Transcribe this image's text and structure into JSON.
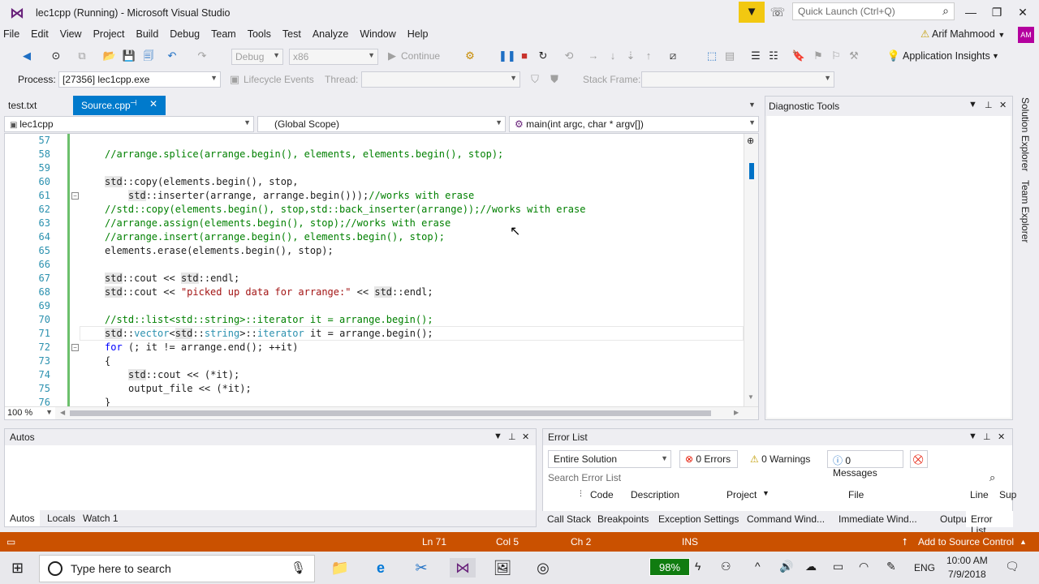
{
  "window": {
    "title": "lec1cpp (Running) - Microsoft Visual Studio",
    "quick_launch_placeholder": "Quick Launch (Ctrl+Q)",
    "minimize": "—",
    "maximize": "❐",
    "close": "✕"
  },
  "menu": [
    "File",
    "Edit",
    "View",
    "Project",
    "Build",
    "Debug",
    "Team",
    "Tools",
    "Test",
    "Analyze",
    "Window",
    "Help"
  ],
  "user": {
    "warning": "⚠",
    "name": "Arif Mahmood",
    "initials": "AM"
  },
  "toolbar": {
    "config": "Debug",
    "platform": "x86",
    "continue_label": "Continue",
    "app_insights": "Application Insights"
  },
  "debug_toolbar": {
    "process_label": "Process:",
    "process_value": "[27356] lec1cpp.exe",
    "lifecycle_label": "Lifecycle Events",
    "thread_label": "Thread:",
    "stack_frame_label": "Stack Frame:"
  },
  "tabs": {
    "tab1": "test.txt",
    "tab2": "Source.cpp"
  },
  "nav": {
    "project": "lec1cpp",
    "scope": "(Global Scope)",
    "member": "main(int argc, char * argv[])"
  },
  "editor": {
    "zoom": "100 %",
    "line_numbers": [
      "57",
      "58",
      "59",
      "60",
      "61",
      "62",
      "63",
      "64",
      "65",
      "66",
      "67",
      "68",
      "69",
      "70",
      "71",
      "72",
      "73",
      "74",
      "75",
      "76"
    ]
  },
  "diagnostic": {
    "title": "Diagnostic Tools"
  },
  "side_tabs": [
    "Solution Explorer",
    "Team Explorer"
  ],
  "autos": {
    "title": "Autos",
    "tabs": [
      "Autos",
      "Locals",
      "Watch 1"
    ]
  },
  "error_list": {
    "title": "Error List",
    "scope": "Entire Solution",
    "errors": "0 Errors",
    "warnings": "0 Warnings",
    "messages": "0 Messages",
    "search_placeholder": "Search Error List",
    "columns": [
      "Code",
      "Description",
      "Project",
      "File",
      "Line",
      "Sup"
    ],
    "tabs": [
      "Call Stack",
      "Breakpoints",
      "Exception Settings",
      "Command Wind...",
      "Immediate Wind...",
      "Output",
      "Error List"
    ]
  },
  "status": {
    "ln": "Ln 71",
    "col": "Col 5",
    "ch": "Ch 2",
    "mode": "INS",
    "source_control": "Add to Source Control"
  },
  "taskbar": {
    "search_placeholder": "Type here to search",
    "battery": "98%",
    "language": "ENG",
    "time": "10:00 AM",
    "date": "7/9/2018"
  },
  "colors": {
    "accent": "#007acc",
    "status_bar": "#ca5100",
    "keyword": "#0000ff",
    "comment": "#008000",
    "string": "#a31515",
    "line_number": "#2b91af"
  }
}
